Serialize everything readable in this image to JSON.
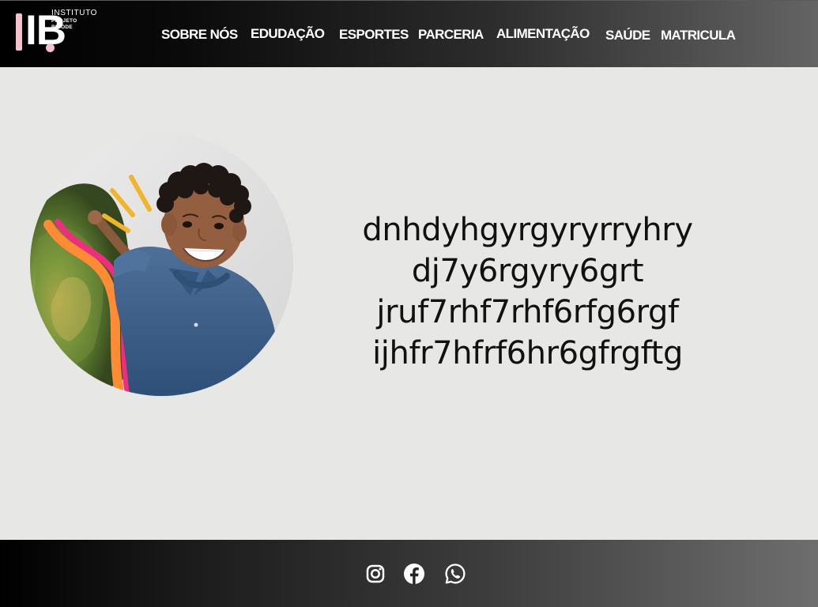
{
  "brand": {
    "mark": "IB",
    "line1": "INSTITUTO",
    "line2": "PROJETO",
    "line3": "BIGODE",
    "accent_color": "#f6c1cf"
  },
  "nav": {
    "items": [
      {
        "label": "SOBRE NÓS"
      },
      {
        "label": "EDUDAÇÃO"
      },
      {
        "label": "ESPORTES"
      },
      {
        "label": "PARCERIA"
      },
      {
        "label": "ALIMENTAÇÃO"
      },
      {
        "label": "SAÚDE"
      },
      {
        "label": "MATRICULA"
      }
    ]
  },
  "hero": {
    "image_subject": "smiling child in blue shirt with colorful brush strokes",
    "lines": [
      "dnhdyhgyrgyryrryhry",
      "dj7y6rgyry6grt",
      "jruf7rhf7rhf6rfg6rgf",
      "ijhfr7hfrf6hr6gfrgftg"
    ]
  },
  "footer": {
    "social": [
      {
        "icon": "instagram-icon"
      },
      {
        "icon": "facebook-icon"
      },
      {
        "icon": "whatsapp-icon"
      }
    ]
  },
  "colors": {
    "page_background": "#e7e7e5",
    "header_footer_dark": "#000000",
    "header_footer_light": "#6e6e6e",
    "text": "#111111"
  }
}
